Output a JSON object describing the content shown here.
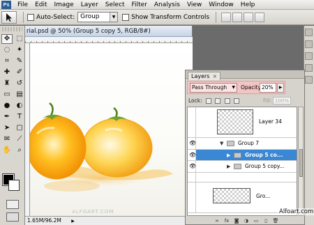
{
  "menubar": {
    "logo": "Ps",
    "items": [
      "File",
      "Edit",
      "Image",
      "Layer",
      "Select",
      "Filter",
      "Analysis",
      "View",
      "Window",
      "Help"
    ]
  },
  "options_bar": {
    "auto_select_label": "Auto-Select:",
    "auto_select_value": "Group",
    "show_transform_label": "Show Transform Controls"
  },
  "document": {
    "title": "rial.psd @ 50% (Group 5 copy 5, RGB/8#)",
    "watermark": "ALFOART.COM",
    "status": "1.65M/96.2M"
  },
  "toolbox": {
    "foreground_color": "#000000",
    "background_color": "#ffffff"
  },
  "layers_panel": {
    "tab_label": "Layers",
    "blend_mode": "Pass Through",
    "opacity_label": "Opacity:",
    "opacity_value": "20%",
    "lock_label": "Lock:",
    "fill_label": "Fill:",
    "fill_value": "100%",
    "layers": [
      {
        "name": "Layer 34",
        "visible": false
      },
      {
        "name": "Group 7",
        "visible": true
      },
      {
        "name": "Group 5 co...",
        "visible": true,
        "selected": true
      },
      {
        "name": "Group 5 copy...",
        "visible": true
      },
      {
        "name": "Gro...",
        "visible": false
      }
    ]
  },
  "site_tag": "Alfoart.com"
}
